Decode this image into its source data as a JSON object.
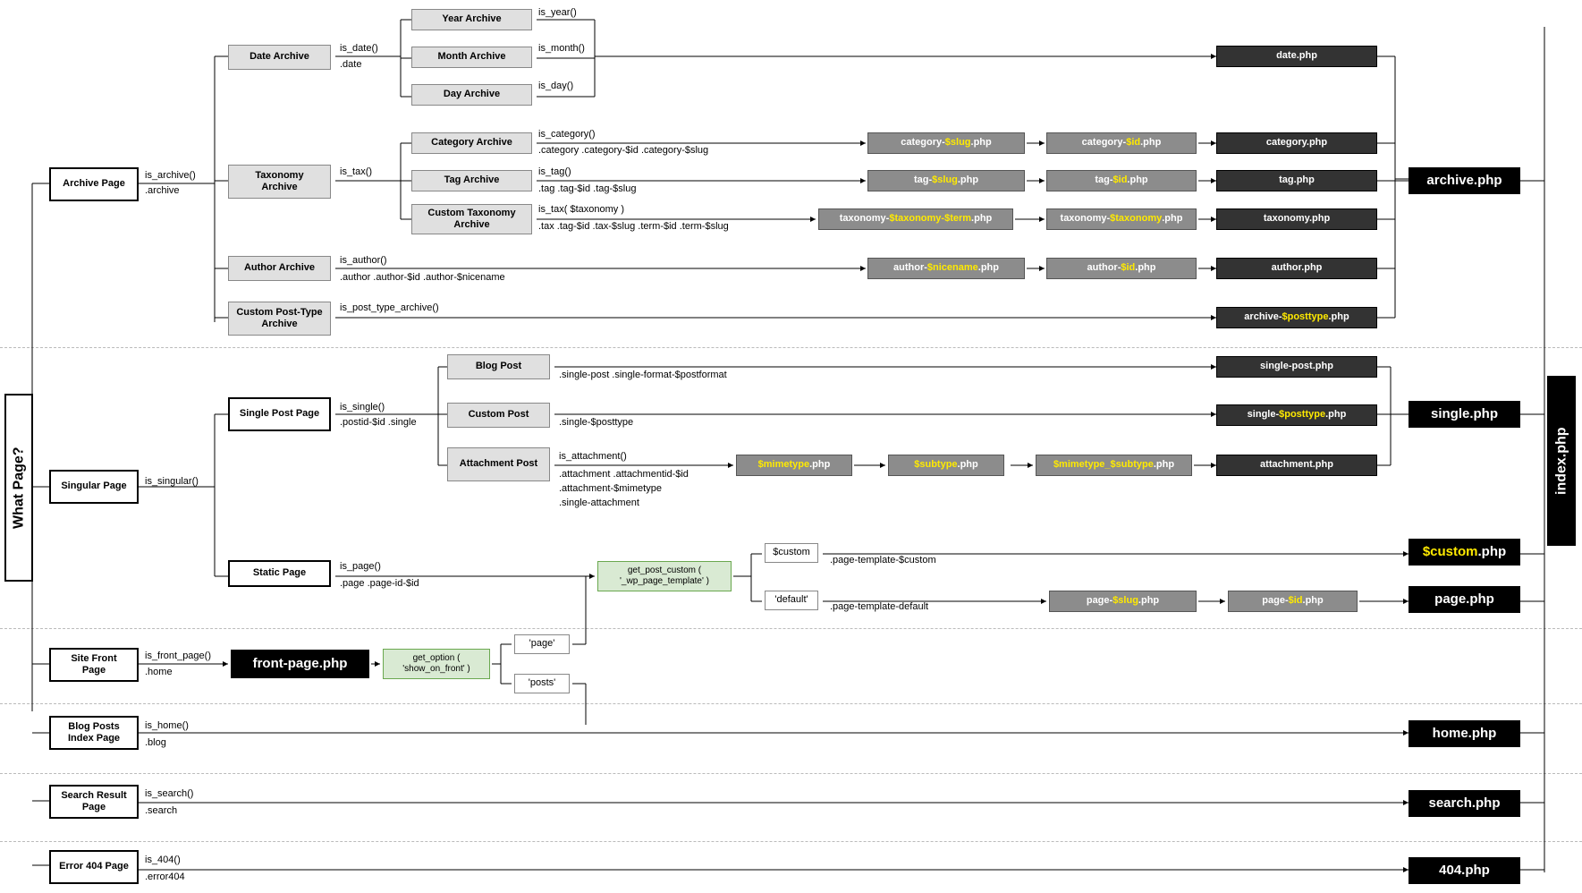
{
  "root": {
    "what_page": "What Page?",
    "index": "index.php"
  },
  "archive": {
    "page": "Archive Page",
    "fn": "is_archive()",
    "cls": ".archive",
    "date": {
      "label": "Date Archive",
      "fn": "is_date()",
      "cls": ".date",
      "year": {
        "label": "Year Archive",
        "fn": "is_year()"
      },
      "month": {
        "label": "Month Archive",
        "fn": "is_month()"
      },
      "day": {
        "label": "Day Archive",
        "fn": "is_day()"
      },
      "php": "date.php"
    },
    "tax": {
      "label": "Taxonomy Archive",
      "fn": "is_tax()",
      "cat": {
        "label": "Category Archive",
        "fn": "is_category()",
        "cls": ".category .category-$id .category-$slug",
        "slug_pre": "category-",
        "slug_hl": "$slug",
        "slug_suf": ".php",
        "id_pre": "category-",
        "id_hl": "$id",
        "id_suf": ".php",
        "php": "category.php"
      },
      "tag": {
        "label": "Tag Archive",
        "fn": "is_tag()",
        "cls": ".tag .tag-$id .tag-$slug",
        "slug_pre": "tag-",
        "slug_hl": "$slug",
        "slug_suf": ".php",
        "id_pre": "tag-",
        "id_hl": "$id",
        "id_suf": ".php",
        "php": "tag.php"
      },
      "cust": {
        "label": "Custom Taxonomy Archive",
        "fn": "is_tax( $taxonomy )",
        "cls": ".tax .tag-$id .tax-$slug .term-$id .term-$slug",
        "slug_pre": "taxonomy-",
        "slug_hl": "$taxonomy-$term",
        "slug_suf": ".php",
        "id_pre": "taxonomy-",
        "id_hl": "$taxonomy",
        "id_suf": ".php",
        "php": "taxonomy.php"
      }
    },
    "author": {
      "label": "Author Archive",
      "fn": "is_author()",
      "cls": ".author .author-$id .author-$nicename",
      "slug_pre": "author-",
      "slug_hl": "$nicename",
      "slug_suf": ".php",
      "id_pre": "author-",
      "id_hl": "$id",
      "id_suf": ".php",
      "php": "author.php"
    },
    "cpt": {
      "label": "Custom Post-Type Archive",
      "fn": "is_post_type_archive()",
      "pre": "archive-",
      "hl": "$posttype",
      "suf": ".php"
    },
    "php": "archive.php"
  },
  "singular": {
    "page": "Singular Page",
    "fn": "is_singular()",
    "single": {
      "label": "Single Post Page",
      "fn": "is_single()",
      "cls": ".postid-$id .single",
      "blog": {
        "label": "Blog Post",
        "cls": ".single-post .single-format-$postformat",
        "php": "single-post.php"
      },
      "custom": {
        "label": "Custom Post",
        "cls": ".single-$posttype",
        "pre": "single-",
        "hl": "$posttype",
        "suf": ".php"
      },
      "attach": {
        "label": "Attachment Post",
        "fn": "is_attachment()",
        "cls1": ".attachment .attachmentid-$id",
        "cls2": ".attachment-$mimetype",
        "cls3": ".single-attachment",
        "m_hl": "$mimetype",
        "m_suf": ".php",
        "s_hl": "$subtype",
        "s_suf": ".php",
        "ms_hl": "$mimetype_$subtype",
        "ms_suf": ".php",
        "php": "attachment.php"
      },
      "php": "single.php"
    },
    "static": {
      "label": "Static Page",
      "fn": "is_page()",
      "cls": ".page .page-id-$id",
      "getpost": "get_post_custom ( '_wp_page_template' )",
      "custom": {
        "opt": "$custom",
        "cls": ".page-template-$custom",
        "hl": "$custom",
        "suf": ".php"
      },
      "default": {
        "opt": "'default'",
        "cls": ".page-template-default",
        "slug_pre": "page-",
        "slug_hl": "$slug",
        "slug_suf": ".php",
        "id_pre": "page-",
        "id_hl": "$id",
        "id_suf": ".php",
        "php": "page.php"
      }
    }
  },
  "front": {
    "page": "Site Front Page",
    "fn": "is_front_page()",
    "cls": ".home",
    "php": "front-page.php",
    "getopt": "get_option ( 'show_on_front' )",
    "page_opt": "'page'",
    "posts_opt": "'posts'"
  },
  "blogidx": {
    "page": "Blog Posts Index Page",
    "fn": "is_home()",
    "cls": ".blog",
    "php": "home.php"
  },
  "search": {
    "page": "Search Result Page",
    "fn": "is_search()",
    "cls": ".search",
    "php": "search.php"
  },
  "error": {
    "page": "Error 404 Page",
    "fn": "is_404()",
    "cls": ".error404",
    "php": "404.php"
  }
}
